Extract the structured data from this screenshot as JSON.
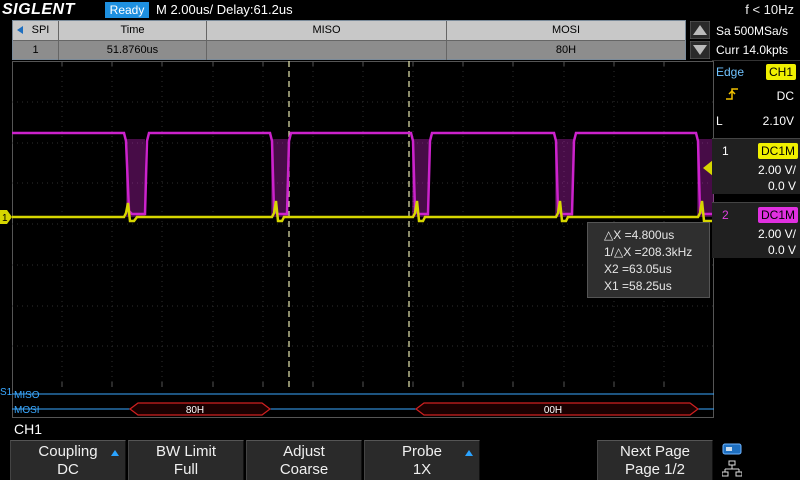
{
  "topbar": {
    "brand": "SIGLENT",
    "status": "Ready",
    "timebase": "M 2.00us/  Delay:61.2us",
    "frequency": "f < 10Hz"
  },
  "decode_table": {
    "headers": [
      "SPI",
      "Time",
      "MISO",
      "MOSI"
    ],
    "row": [
      "1",
      "51.8760us",
      "",
      "80H"
    ]
  },
  "channels": {
    "ch1_color": "#d6d600",
    "ch2_color": "#cc22cc",
    "decode_color": "#3aa8ff",
    "ch1_marker": "1"
  },
  "decode_lines": {
    "bus_label": "S1",
    "miso_label": "MISO",
    "mosi_label": "MOSI",
    "mosi_frames": [
      "80H",
      "00H"
    ]
  },
  "measurements": {
    "delta_x": "△X =4.800us",
    "inv_delta_x": "1/△X =208.3kHz",
    "x2": "X2 =63.05us",
    "x1": "X1 =58.25us"
  },
  "right_panel": {
    "sample_rate": "Sa 500MSa/s",
    "memory": "Curr 14.0kpts",
    "trigger_type": "Edge",
    "trigger_source": "CH1",
    "trigger_coupling": "DC",
    "trigger_level_label": "L",
    "trigger_level": "2.10V",
    "ch1": {
      "number": "1",
      "coupling": "DC1M",
      "scale": "2.00 V/",
      "offset": "0.0 V"
    },
    "ch2": {
      "number": "2",
      "coupling": "DC1M",
      "scale": "2.00 V/",
      "offset": "0.0 V"
    }
  },
  "bottom": {
    "menu_title": "CH1",
    "softkeys": [
      {
        "line1": "Coupling",
        "line2": "DC"
      },
      {
        "line1": "BW Limit",
        "line2": "Full"
      },
      {
        "line1": "Adjust",
        "line2": "Coarse"
      },
      {
        "line1": "Probe",
        "line2": "1X"
      },
      {
        "line1": "Next Page",
        "line2": "Page 1/2"
      }
    ]
  }
}
